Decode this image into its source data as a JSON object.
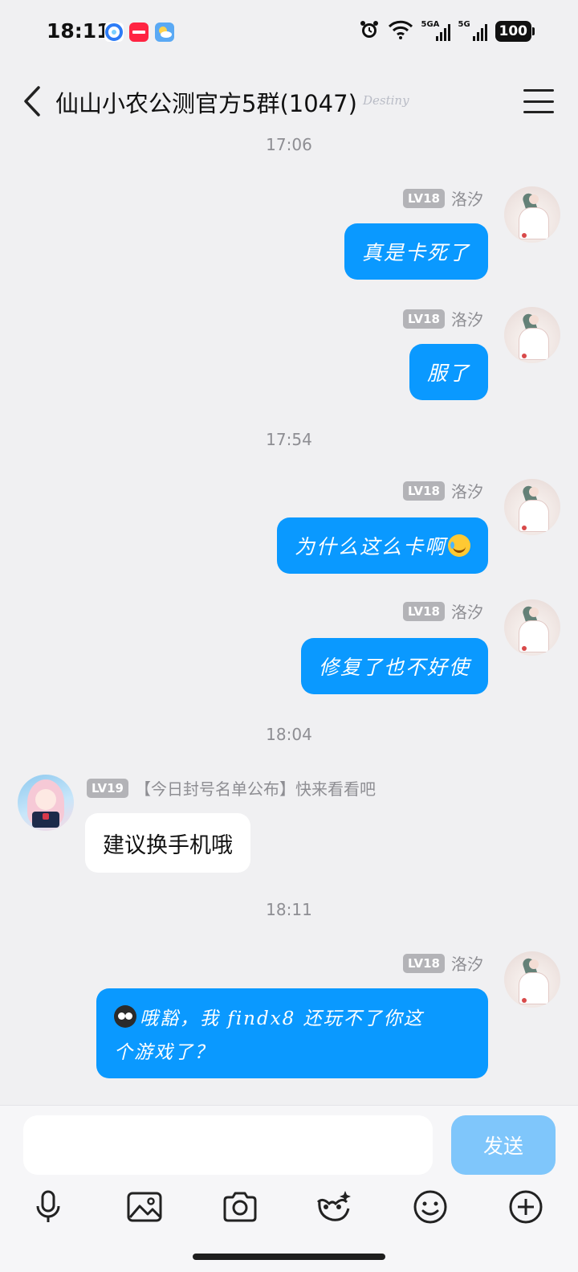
{
  "status_bar": {
    "time": "18:11",
    "app_icons": [
      {
        "name": "browser-app-icon",
        "color": "#2d7cf6"
      },
      {
        "name": "xiaohongshu-app-icon",
        "color": "#ff2442"
      },
      {
        "name": "weather-app-icon",
        "color": "#5aa9f4"
      }
    ],
    "signal_1_label": "5GA",
    "signal_2_label": "5G",
    "battery": "100"
  },
  "header": {
    "title": "仙山小农公测官方5群(1047)",
    "decoration": "Destiny"
  },
  "messages": [
    {
      "type": "timestamp",
      "text": "17:06"
    },
    {
      "type": "message",
      "side": "right",
      "level": "LV18",
      "sender": "洛汐",
      "text": "真是卡死了"
    },
    {
      "type": "message",
      "side": "right",
      "level": "LV18",
      "sender": "洛汐",
      "text": "服了"
    },
    {
      "type": "timestamp",
      "text": "17:54"
    },
    {
      "type": "message",
      "side": "right",
      "level": "LV18",
      "sender": "洛汐",
      "text": "为什么这么卡啊",
      "trailing_emoji": "crying-laugh-emoji"
    },
    {
      "type": "message",
      "side": "right",
      "level": "LV18",
      "sender": "洛汐",
      "text": "修复了也不好使"
    },
    {
      "type": "timestamp",
      "text": "18:04"
    },
    {
      "type": "message",
      "side": "left",
      "level": "LV19",
      "sender": "【今日封号名单公布】快来看看吧",
      "text": "建议换手机哦"
    },
    {
      "type": "timestamp",
      "text": "18:11"
    },
    {
      "type": "message",
      "side": "right",
      "level": "LV18",
      "sender": "洛汐",
      "leading_emoji": "owl-emoji",
      "text_line1": "哦豁，我 findx8 还玩不了你这",
      "text_line2": "个游戏了？"
    }
  ],
  "input": {
    "value": "",
    "placeholder": "",
    "send_label": "发送"
  },
  "toolbar": [
    {
      "name": "microphone-icon"
    },
    {
      "name": "image-icon"
    },
    {
      "name": "camera-icon"
    },
    {
      "name": "sticker-icon"
    },
    {
      "name": "emoji-icon"
    },
    {
      "name": "plus-icon"
    }
  ],
  "colors": {
    "accent": "#0a99ff",
    "background": "#f0f0f2",
    "send_disabled": "#7fc6fb",
    "level_badge": "#b3b3b7"
  }
}
